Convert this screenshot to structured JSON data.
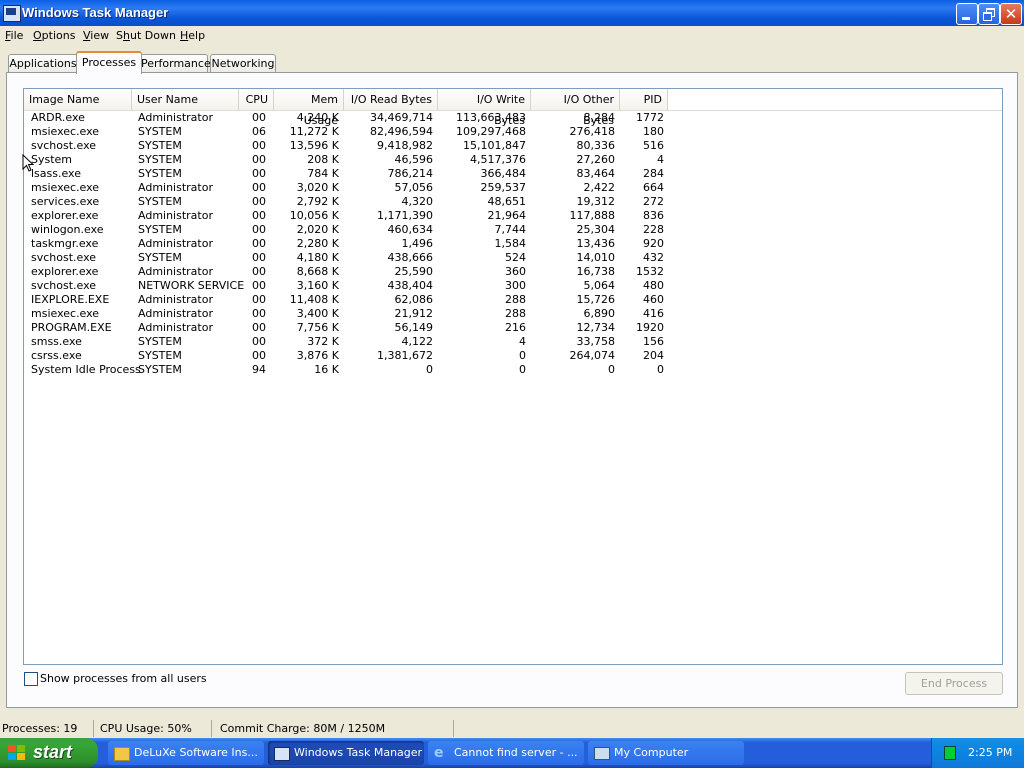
{
  "window": {
    "title": "Windows Task Manager"
  },
  "menu": [
    {
      "label": "File",
      "u": "F",
      "rest": "ile"
    },
    {
      "label": "Options",
      "u": "O",
      "rest": "ptions"
    },
    {
      "label": "View",
      "u": "V",
      "rest": "iew"
    },
    {
      "label": "Shut Down",
      "pre": "S",
      "u": "h",
      "rest": "ut Down"
    },
    {
      "label": "Help",
      "u": "H",
      "rest": "elp"
    }
  ],
  "tabs": [
    "Applications",
    "Processes",
    "Performance",
    "Networking"
  ],
  "active_tab": "Processes",
  "columns": [
    "Image Name",
    "User Name",
    "CPU",
    "Mem Usage",
    "I/O Read Bytes",
    "I/O Write Bytes",
    "I/O Other Bytes",
    "PID"
  ],
  "processes": [
    [
      "ARDR.exe",
      "Administrator",
      "00",
      "4,240 K",
      "34,469,714",
      "113,663,483",
      "8,284",
      "1772"
    ],
    [
      "msiexec.exe",
      "SYSTEM",
      "06",
      "11,272 K",
      "82,496,594",
      "109,297,468",
      "276,418",
      "180"
    ],
    [
      "svchost.exe",
      "SYSTEM",
      "00",
      "13,596 K",
      "9,418,982",
      "15,101,847",
      "80,336",
      "516"
    ],
    [
      "System",
      "SYSTEM",
      "00",
      "208 K",
      "46,596",
      "4,517,376",
      "27,260",
      "4"
    ],
    [
      "lsass.exe",
      "SYSTEM",
      "00",
      "784 K",
      "786,214",
      "366,484",
      "83,464",
      "284"
    ],
    [
      "msiexec.exe",
      "Administrator",
      "00",
      "3,020 K",
      "57,056",
      "259,537",
      "2,422",
      "664"
    ],
    [
      "services.exe",
      "SYSTEM",
      "00",
      "2,792 K",
      "4,320",
      "48,651",
      "19,312",
      "272"
    ],
    [
      "explorer.exe",
      "Administrator",
      "00",
      "10,056 K",
      "1,171,390",
      "21,964",
      "117,888",
      "836"
    ],
    [
      "winlogon.exe",
      "SYSTEM",
      "00",
      "2,020 K",
      "460,634",
      "7,744",
      "25,304",
      "228"
    ],
    [
      "taskmgr.exe",
      "Administrator",
      "00",
      "2,280 K",
      "1,496",
      "1,584",
      "13,436",
      "920"
    ],
    [
      "svchost.exe",
      "SYSTEM",
      "00",
      "4,180 K",
      "438,666",
      "524",
      "14,010",
      "432"
    ],
    [
      "explorer.exe",
      "Administrator",
      "00",
      "8,668 K",
      "25,590",
      "360",
      "16,738",
      "1532"
    ],
    [
      "svchost.exe",
      "NETWORK SERVICE",
      "00",
      "3,160 K",
      "438,404",
      "300",
      "5,064",
      "480"
    ],
    [
      "IEXPLORE.EXE",
      "Administrator",
      "00",
      "11,408 K",
      "62,086",
      "288",
      "15,726",
      "460"
    ],
    [
      "msiexec.exe",
      "Administrator",
      "00",
      "3,400 K",
      "21,912",
      "288",
      "6,890",
      "416"
    ],
    [
      "PROGRAM.EXE",
      "Administrator",
      "00",
      "7,756 K",
      "56,149",
      "216",
      "12,734",
      "1920"
    ],
    [
      "smss.exe",
      "SYSTEM",
      "00",
      "372 K",
      "4,122",
      "4",
      "33,758",
      "156"
    ],
    [
      "csrss.exe",
      "SYSTEM",
      "00",
      "3,876 K",
      "1,381,672",
      "0",
      "264,074",
      "204"
    ],
    [
      "System Idle Process",
      "SYSTEM",
      "94",
      "16 K",
      "0",
      "0",
      "0",
      "0"
    ]
  ],
  "show_all_label": "Show processes from all users",
  "end_process_label": "End Process",
  "status": {
    "processes": "Processes: 19",
    "cpu": "CPU Usage: 50%",
    "commit": "Commit Charge: 80M / 1250M"
  },
  "taskbar": {
    "start": "start",
    "tasks": [
      {
        "label": "DeLuXe Software Ins...",
        "icon": "folder-icon"
      },
      {
        "label": "Windows Task Manager",
        "icon": "taskmgr-icon",
        "active": true
      },
      {
        "label": "Cannot find server - ...",
        "icon": "ie-icon"
      },
      {
        "label": "My Computer",
        "icon": "computer-icon"
      }
    ],
    "clock": "2:25 PM"
  }
}
